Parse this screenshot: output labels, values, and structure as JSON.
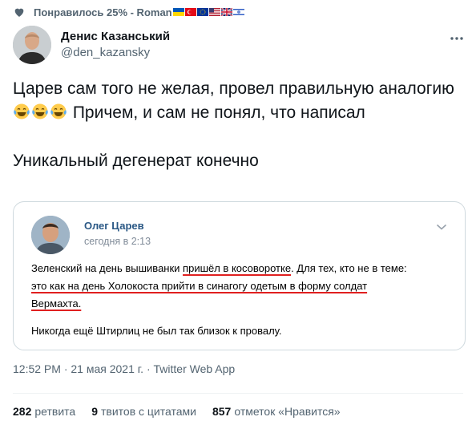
{
  "social_context": {
    "text": "Понравилось 25% - Roman",
    "icon": "heart-icon",
    "flags": [
      "ukraine-flag",
      "turkey-flag",
      "eu-flag",
      "usa-flag",
      "uk-flag",
      "israel-flag"
    ]
  },
  "author": {
    "name": "Денис Казанський",
    "handle": "@den_kazansky"
  },
  "tweet": {
    "paragraph1_before": "Царев сам того не желая, провел правильную аналогию",
    "paragraph1_after": " Причем, и сам не понял, что написал",
    "emojis": [
      "face-with-tears-of-joy",
      "face-with-tears-of-joy",
      "face-with-tears-of-joy"
    ],
    "paragraph2": "Уникальный дегенерат конечно"
  },
  "quote": {
    "name": "Олег Царев",
    "time": "сегодня в 2:13",
    "line1_a": "Зеленский на день вышиванки ",
    "line1_u": "пришёл в косоворотке",
    "line1_b": ". Для тех, кто не в теме:",
    "line2_u": "это как на день Холокоста прийти в синагогу одетым в форму солдат",
    "line3_u": "Вермахта.",
    "line4": "Никогда ещё Штирлиц не был так близок к провалу."
  },
  "timestamp": {
    "time": "12:52 PM",
    "sep": " · ",
    "date": "21 мая 2021 г.",
    "source": "Twitter Web App"
  },
  "stats": {
    "retweets": "282",
    "retweets_label": "ретвита",
    "quotes": "9",
    "quotes_label": "твитов с цитатами",
    "likes": "857",
    "likes_label": "отметок «Нравится»"
  },
  "colors": {
    "link_blue": "#2a5885",
    "underline_red": "#e02020",
    "secondary_text": "#536471"
  }
}
